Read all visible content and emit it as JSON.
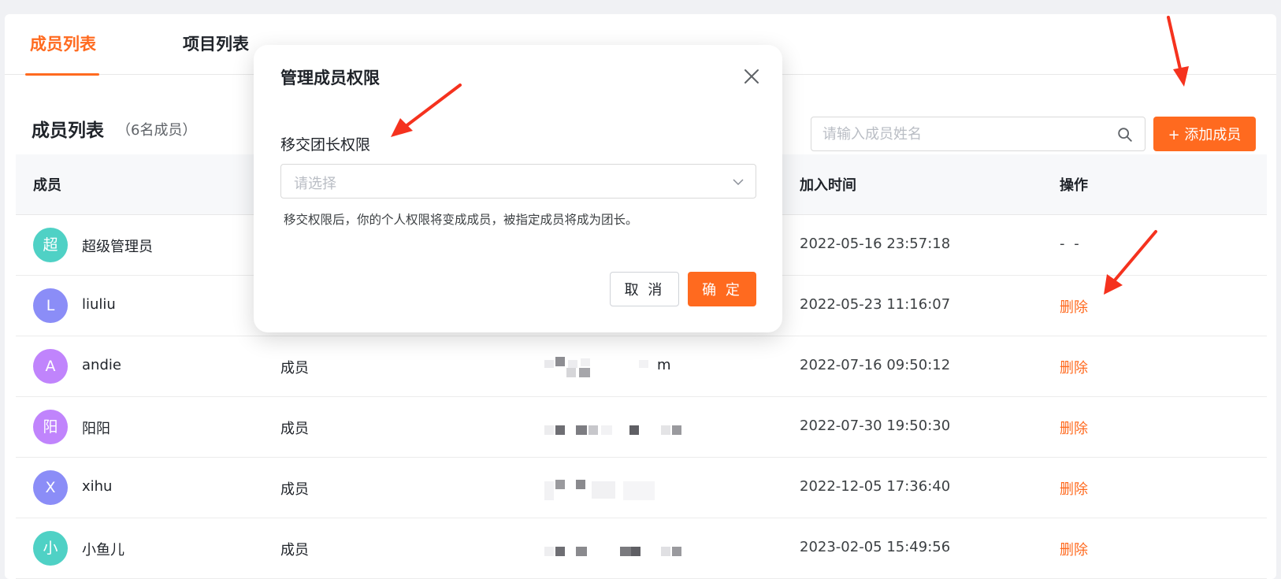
{
  "colors": {
    "accent": "#ff6a1f",
    "annotation_arrow": "#f5321e",
    "avatar_teal": "#4fd1c5",
    "avatar_indigo": "#8b8df7",
    "avatar_purple": "#c084fc"
  },
  "tabs": [
    {
      "label": "成员列表",
      "active": true
    },
    {
      "label": "项目列表",
      "active": false
    }
  ],
  "section": {
    "title": "成员列表",
    "count": "（6名成员）"
  },
  "search": {
    "placeholder": "请输入成员姓名",
    "icon": "search-icon"
  },
  "add_button": {
    "label": "+ 添加成员"
  },
  "table": {
    "headers": {
      "member": "成员",
      "join_time": "加入时间",
      "operation": "操作"
    },
    "rows": [
      {
        "avatar": "超",
        "name": "超级管理员",
        "role": "",
        "email_tail": "",
        "join_time": "2022-05-16 23:57:18",
        "op": "- -",
        "op_kind": "none",
        "avatar_color": "teal"
      },
      {
        "avatar": "L",
        "name": "liuliu",
        "role": "",
        "email_tail": "",
        "join_time": "2022-05-23 11:16:07",
        "op": "删除",
        "op_kind": "delete",
        "avatar_color": "indigo"
      },
      {
        "avatar": "A",
        "name": "andie",
        "role": "成员",
        "email_tail": "m",
        "join_time": "2022-07-16 09:50:12",
        "op": "删除",
        "op_kind": "delete",
        "avatar_color": "purple"
      },
      {
        "avatar": "阳",
        "name": "阳阳",
        "role": "成员",
        "email_tail": "",
        "join_time": "2022-07-30 19:50:30",
        "op": "删除",
        "op_kind": "delete",
        "avatar_color": "purple"
      },
      {
        "avatar": "X",
        "name": "xihu",
        "role": "成员",
        "email_tail": "",
        "join_time": "2022-12-05 17:36:40",
        "op": "删除",
        "op_kind": "delete",
        "avatar_color": "indigo"
      },
      {
        "avatar": "小",
        "name": "小鱼儿",
        "role": "成员",
        "email_tail": "",
        "join_time": "2023-02-05 15:49:56",
        "op": "删除",
        "op_kind": "delete",
        "avatar_color": "teal"
      }
    ]
  },
  "modal": {
    "title": "管理成员权限",
    "field_label": "移交团长权限",
    "select_placeholder": "请选择",
    "hint": "移交权限后，你的个人权限将变成成员，被指定成员将成为团长。",
    "cancel_label": "取 消",
    "confirm_label": "确 定"
  }
}
